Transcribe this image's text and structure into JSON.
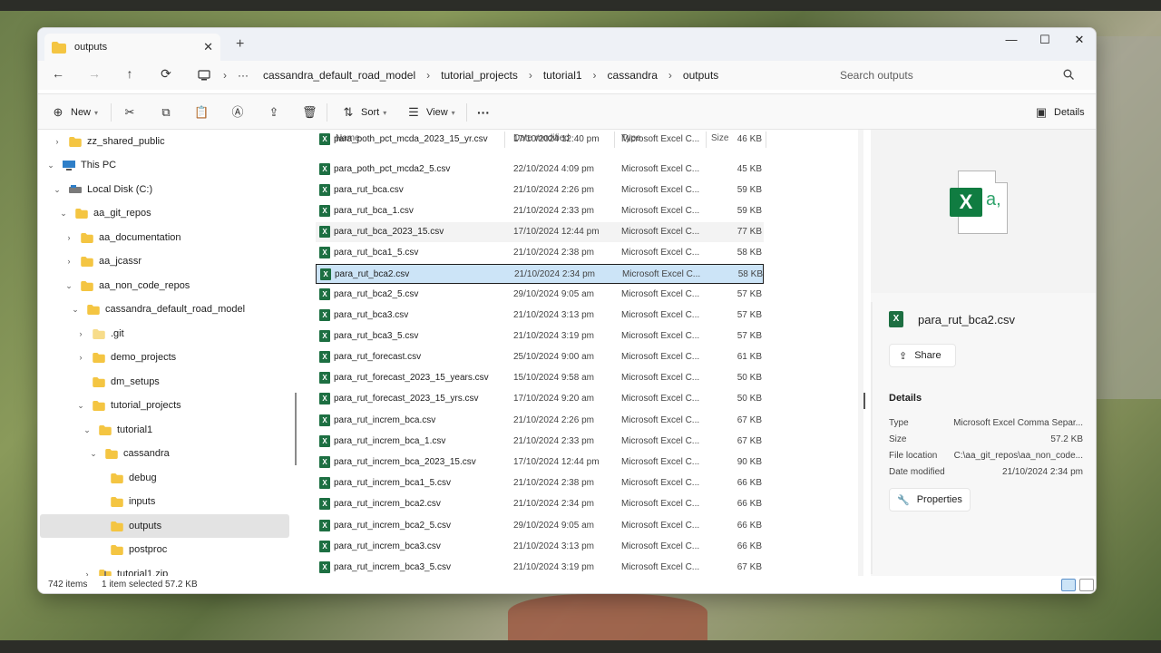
{
  "window": {
    "tab_title": "outputs",
    "tab_close": "✕",
    "new_tab": "+",
    "minimize": "—",
    "maximize": "☐",
    "close": "✕"
  },
  "nav": {
    "back": "←",
    "forward": "→",
    "up": "↑",
    "refresh": "⟳",
    "more": "···",
    "breadcrumbs": [
      "cassandra_default_road_model",
      "tutorial_projects",
      "tutorial1",
      "cassandra",
      "outputs"
    ],
    "separator": "›",
    "search_placeholder": "Search outputs"
  },
  "toolbar": {
    "new_label": "New",
    "sort_label": "Sort",
    "view_label": "View",
    "more_label": "···",
    "details_label": "Details"
  },
  "sidebar": {
    "items": [
      {
        "label": "zz_shared_public",
        "chev": "›"
      },
      {
        "label": "This PC",
        "chev": "⌄"
      },
      {
        "label": "Local Disk (C:)",
        "chev": "⌄"
      },
      {
        "label": "aa_git_repos",
        "chev": "⌄"
      },
      {
        "label": "aa_documentation",
        "chev": "›"
      },
      {
        "label": "aa_jcassr",
        "chev": "›"
      },
      {
        "label": "aa_non_code_repos",
        "chev": "⌄"
      },
      {
        "label": "cassandra_default_road_model",
        "chev": "⌄"
      },
      {
        "label": ".git",
        "chev": "›"
      },
      {
        "label": "demo_projects",
        "chev": "›"
      },
      {
        "label": "dm_setups",
        "chev": ""
      },
      {
        "label": "tutorial_projects",
        "chev": "⌄"
      },
      {
        "label": "tutorial1",
        "chev": "⌄"
      },
      {
        "label": "cassandra",
        "chev": "⌄"
      },
      {
        "label": "debug",
        "chev": ""
      },
      {
        "label": "inputs",
        "chev": ""
      },
      {
        "label": "outputs",
        "chev": ""
      },
      {
        "label": "postproc",
        "chev": ""
      },
      {
        "label": "tutorial1.zip",
        "chev": "›"
      }
    ]
  },
  "columns": {
    "name": "Name",
    "date": "Date modified",
    "type": "Type",
    "size": "Size"
  },
  "files": [
    {
      "name": "para_poth_pct_mcda_2023_15_yr.csv",
      "date": "17/10/2024 12:40 pm",
      "type": "Microsoft Excel C...",
      "size": "46 KB"
    },
    {
      "name": "para_poth_pct_mcda2_5.csv",
      "date": "22/10/2024 4:09 pm",
      "type": "Microsoft Excel C...",
      "size": "45 KB"
    },
    {
      "name": "para_rut_bca.csv",
      "date": "21/10/2024 2:26 pm",
      "type": "Microsoft Excel C...",
      "size": "59 KB"
    },
    {
      "name": "para_rut_bca_1.csv",
      "date": "21/10/2024 2:33 pm",
      "type": "Microsoft Excel C...",
      "size": "59 KB"
    },
    {
      "name": "para_rut_bca_2023_15.csv",
      "date": "17/10/2024 12:44 pm",
      "type": "Microsoft Excel C...",
      "size": "77 KB"
    },
    {
      "name": "para_rut_bca1_5.csv",
      "date": "21/10/2024 2:38 pm",
      "type": "Microsoft Excel C...",
      "size": "58 KB"
    },
    {
      "name": "para_rut_bca2.csv",
      "date": "21/10/2024 2:34 pm",
      "type": "Microsoft Excel C...",
      "size": "58 KB"
    },
    {
      "name": "para_rut_bca2_5.csv",
      "date": "29/10/2024 9:05 am",
      "type": "Microsoft Excel C...",
      "size": "57 KB"
    },
    {
      "name": "para_rut_bca3.csv",
      "date": "21/10/2024 3:13 pm",
      "type": "Microsoft Excel C...",
      "size": "57 KB"
    },
    {
      "name": "para_rut_bca3_5.csv",
      "date": "21/10/2024 3:19 pm",
      "type": "Microsoft Excel C...",
      "size": "57 KB"
    },
    {
      "name": "para_rut_forecast.csv",
      "date": "25/10/2024 9:00 am",
      "type": "Microsoft Excel C...",
      "size": "61 KB"
    },
    {
      "name": "para_rut_forecast_2023_15_years.csv",
      "date": "15/10/2024 9:58 am",
      "type": "Microsoft Excel C...",
      "size": "50 KB"
    },
    {
      "name": "para_rut_forecast_2023_15_yrs.csv",
      "date": "17/10/2024 9:20 am",
      "type": "Microsoft Excel C...",
      "size": "50 KB"
    },
    {
      "name": "para_rut_increm_bca.csv",
      "date": "21/10/2024 2:26 pm",
      "type": "Microsoft Excel C...",
      "size": "67 KB"
    },
    {
      "name": "para_rut_increm_bca_1.csv",
      "date": "21/10/2024 2:33 pm",
      "type": "Microsoft Excel C...",
      "size": "67 KB"
    },
    {
      "name": "para_rut_increm_bca_2023_15.csv",
      "date": "17/10/2024 12:44 pm",
      "type": "Microsoft Excel C...",
      "size": "90 KB"
    },
    {
      "name": "para_rut_increm_bca1_5.csv",
      "date": "21/10/2024 2:38 pm",
      "type": "Microsoft Excel C...",
      "size": "66 KB"
    },
    {
      "name": "para_rut_increm_bca2.csv",
      "date": "21/10/2024 2:34 pm",
      "type": "Microsoft Excel C...",
      "size": "66 KB"
    },
    {
      "name": "para_rut_increm_bca2_5.csv",
      "date": "29/10/2024 9:05 am",
      "type": "Microsoft Excel C...",
      "size": "66 KB"
    },
    {
      "name": "para_rut_increm_bca3.csv",
      "date": "21/10/2024 3:13 pm",
      "type": "Microsoft Excel C...",
      "size": "66 KB"
    },
    {
      "name": "para_rut_increm_bca3_5.csv",
      "date": "21/10/2024 3:19 pm",
      "type": "Microsoft Excel C...",
      "size": "67 KB"
    }
  ],
  "details": {
    "file_name": "para_rut_bca2.csv",
    "share_label": "Share",
    "section_title": "Details",
    "props": [
      {
        "k": "Type",
        "v": "Microsoft Excel Comma Separ..."
      },
      {
        "k": "Size",
        "v": "57.2 KB"
      },
      {
        "k": "File location",
        "v": "C:\\aa_git_repos\\aa_non_code..."
      },
      {
        "k": "Date modified",
        "v": "21/10/2024 2:34 pm"
      }
    ],
    "properties_label": "Properties"
  },
  "status": {
    "count": "742 items",
    "selected": "1 item selected  57.2 KB"
  },
  "colors": {
    "accent": "#0067c0",
    "excel": "#1d6f42",
    "selection": "#cce4f7",
    "folder": "#f4c542"
  }
}
